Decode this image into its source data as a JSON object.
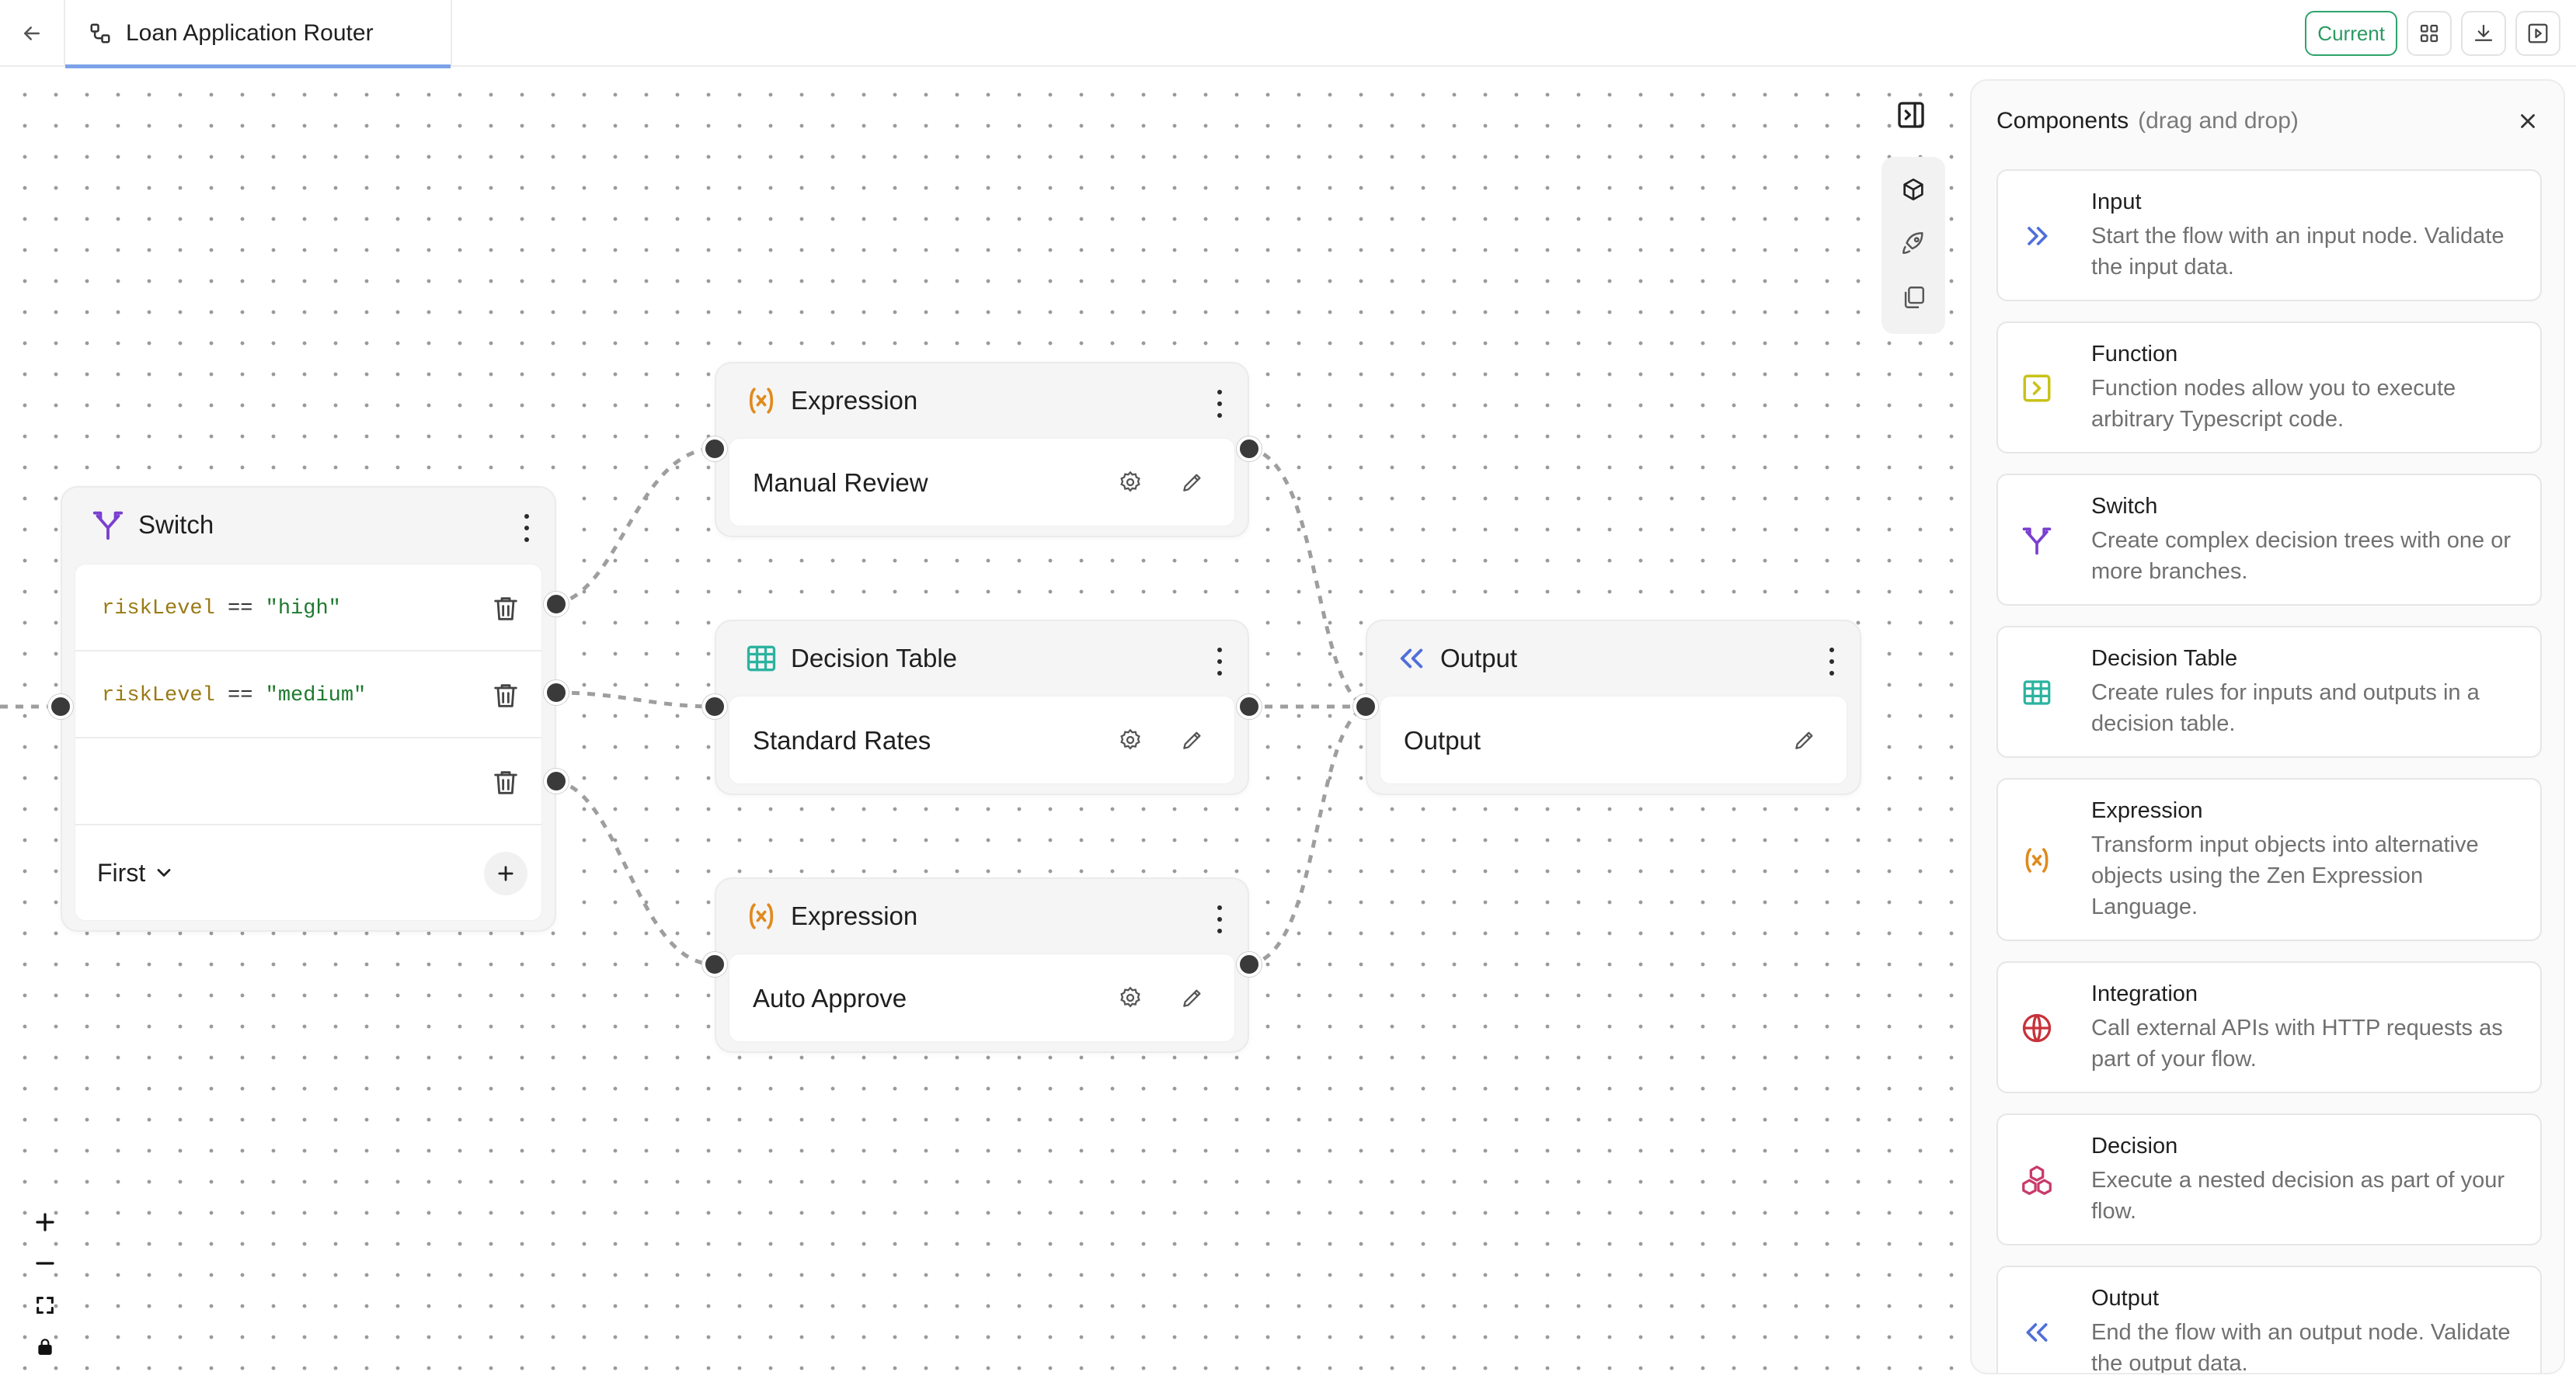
{
  "header": {
    "tab_title": "Loan Application Router",
    "current_label": "Current"
  },
  "nodes": {
    "switch": {
      "title": "Switch",
      "conditions": [
        {
          "var": "riskLevel",
          "op": " == ",
          "value": "\"high\""
        },
        {
          "var": "riskLevel",
          "op": " == ",
          "value": "\"medium\""
        },
        {
          "var": "",
          "op": "",
          "value": ""
        }
      ],
      "mode_label": "First"
    },
    "expression_top": {
      "title": "Expression",
      "label": "Manual Review"
    },
    "decision_table": {
      "title": "Decision Table",
      "label": "Standard Rates"
    },
    "expression_bottom": {
      "title": "Expression",
      "label": "Auto Approve"
    },
    "output": {
      "title": "Output",
      "label": "Output"
    }
  },
  "panel": {
    "title": "Components",
    "subtitle": "(drag and drop)",
    "items": [
      {
        "title": "Input",
        "desc": "Start the flow with an input node. Validate the input data.",
        "icon": "input-icon",
        "color": "#4f6fd9"
      },
      {
        "title": "Function",
        "desc": "Function nodes allow you to execute arbitrary Typescript code.",
        "icon": "function-icon",
        "color": "#c9c21a"
      },
      {
        "title": "Switch",
        "desc": "Create complex decision trees with one or more branches.",
        "icon": "switch-icon",
        "color": "#7a3fd0"
      },
      {
        "title": "Decision Table",
        "desc": "Create rules for inputs and outputs in a decision table.",
        "icon": "table-icon",
        "color": "#2bb3a0"
      },
      {
        "title": "Expression",
        "desc": "Transform input objects into alternative objects using the Zen Expression Language.",
        "icon": "expression-icon",
        "color": "#e08a1e"
      },
      {
        "title": "Integration",
        "desc": "Call external APIs with HTTP requests as part of your flow.",
        "icon": "globe-icon",
        "color": "#c8323b"
      },
      {
        "title": "Decision",
        "desc": "Execute a nested decision as part of your flow.",
        "icon": "decision-icon",
        "color": "#c83a6a"
      },
      {
        "title": "Output",
        "desc": "End the flow with an output node. Validate the output data.",
        "icon": "output-icon",
        "color": "#4f6fd9"
      }
    ]
  }
}
